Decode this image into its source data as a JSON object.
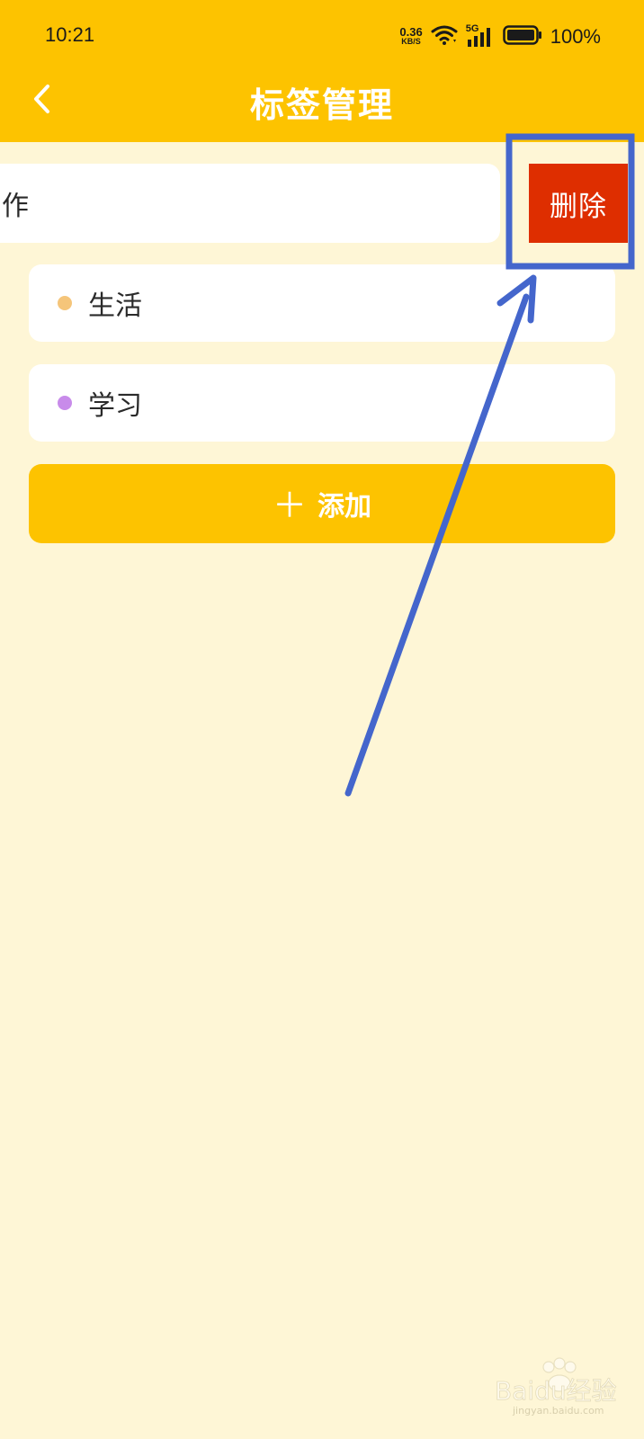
{
  "status_bar": {
    "time": "10:21",
    "net_speed_value": "0.36",
    "net_speed_unit": "KB/S",
    "network_type": "5G",
    "battery_percent": "100%"
  },
  "header": {
    "title": "标签管理",
    "back_icon": "chevron-left-icon"
  },
  "tags": [
    {
      "label": "作",
      "swiped": true
    },
    {
      "label": "生活",
      "dot_color": "#F5C57A"
    },
    {
      "label": "学习",
      "dot_color": "#C88BEA"
    }
  ],
  "delete_label": "删除",
  "add_button": {
    "plus": "＋",
    "label": "添加"
  },
  "colors": {
    "header_bg": "#FDC300",
    "page_bg": "#FEF6D6",
    "delete_bg": "#DE2E00",
    "annotation": "#4466CC"
  },
  "watermark": {
    "brand": "Baidu经验",
    "url": "jingyan.baidu.com"
  }
}
